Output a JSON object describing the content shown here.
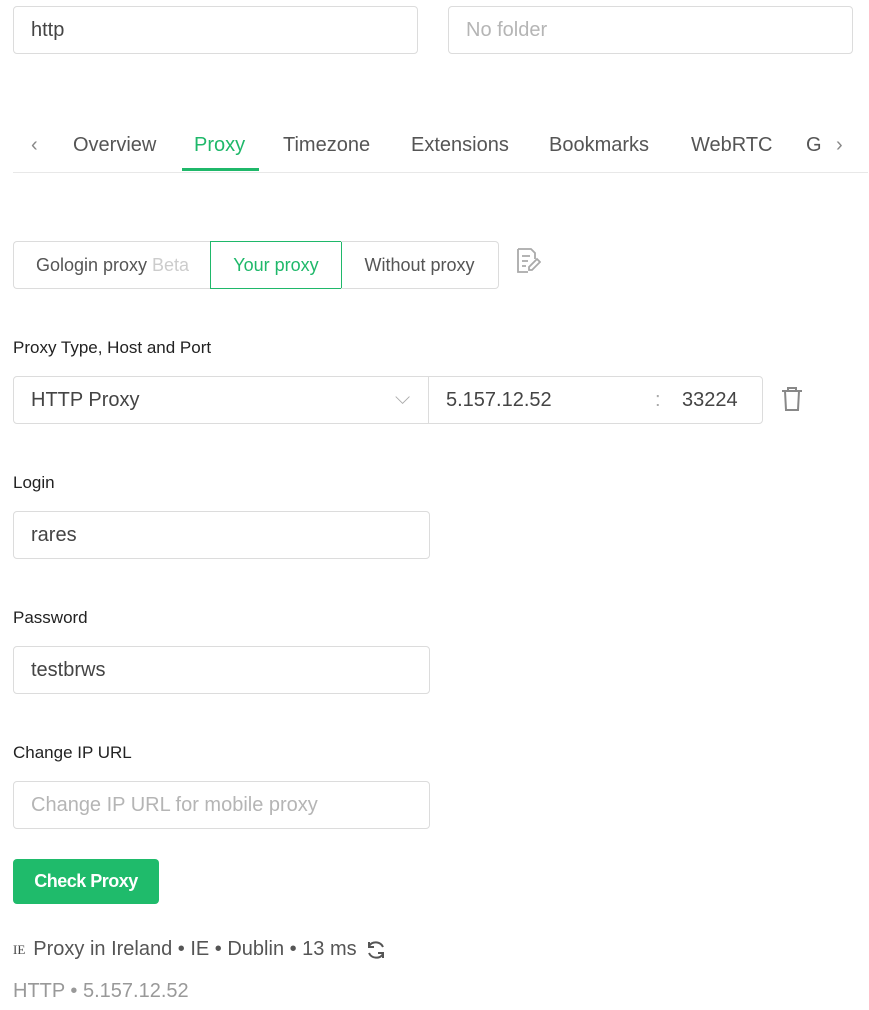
{
  "top": {
    "name_value": "http",
    "folder_placeholder": "No folder"
  },
  "tabs": [
    {
      "label": "Overview"
    },
    {
      "label": "Proxy",
      "active": true
    },
    {
      "label": "Timezone"
    },
    {
      "label": "Extensions"
    },
    {
      "label": "Bookmarks"
    },
    {
      "label": "WebRTC"
    },
    {
      "label": "G"
    }
  ],
  "proxy_mode": {
    "gologin": "Gologin proxy",
    "beta": "Beta",
    "your": "Your proxy",
    "without": "Without proxy",
    "selected": "Your proxy"
  },
  "fields": {
    "type_host_port_label": "Proxy Type, Host and Port",
    "type": "HTTP Proxy",
    "host": "5.157.12.52",
    "separator": ":",
    "port": "33224",
    "login_label": "Login",
    "login": "rares",
    "password_label": "Password",
    "password": "testbrws",
    "change_ip_label": "Change IP URL",
    "change_ip_placeholder": "Change IP URL for mobile proxy"
  },
  "check_button": "Check Proxy",
  "status": {
    "flag": "IE",
    "line": "Proxy in Ireland • IE • Dublin • 13 ms",
    "sub": "HTTP • 5.157.12.52"
  },
  "colors": {
    "accent": "#1fb86a"
  }
}
